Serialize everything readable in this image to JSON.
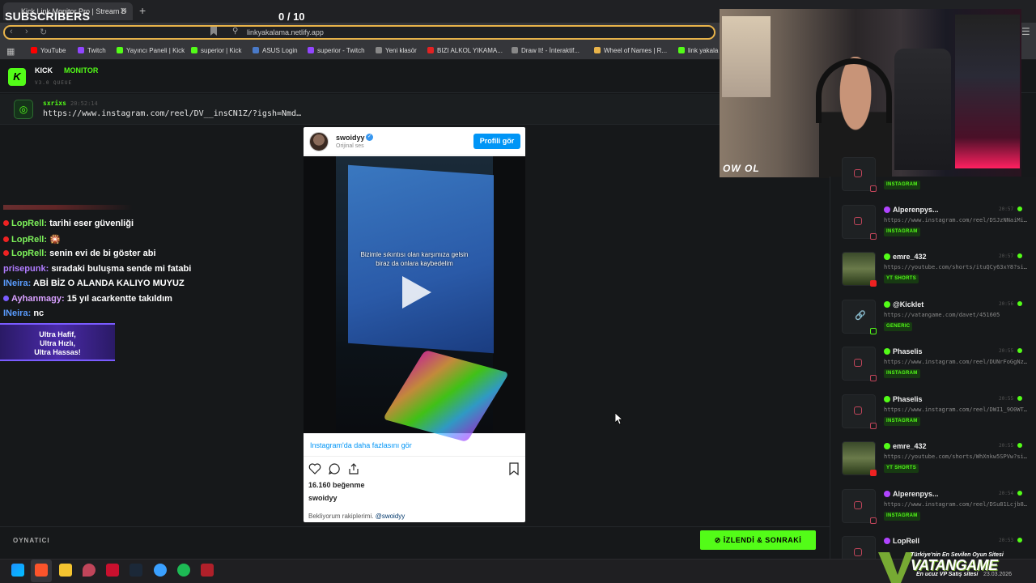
{
  "browser": {
    "tab_title": "Kick Link Monitor Pro | Stream D",
    "url": "linkyakalama.netlify.app",
    "bookmarks": [
      {
        "label": "YouTube",
        "color": "#ff0000"
      },
      {
        "label": "Twitch",
        "color": "#9146ff"
      },
      {
        "label": "Yayıncı Paneli | Kick",
        "color": "#53fc18"
      },
      {
        "label": "superior | Kick",
        "color": "#53fc18"
      },
      {
        "label": "ASUS Login",
        "color": "#4a7ac8"
      },
      {
        "label": "superior - Twitch",
        "color": "#9146ff"
      },
      {
        "label": "Yeni klasör",
        "color": "#888888"
      },
      {
        "label": "BIZI ALKOL YIKAMA...",
        "color": "#e22222"
      },
      {
        "label": "Draw It! - İnteraktif...",
        "color": "#888888"
      },
      {
        "label": "Wheel of Names | R...",
        "color": "#e8b34a"
      },
      {
        "label": "link yakala",
        "color": "#53fc18"
      }
    ]
  },
  "overlay": {
    "subscribers_label": "SUBSCRIBERS",
    "counter": "0 / 10"
  },
  "app": {
    "brand_a": "KICK",
    "brand_b": "MONITOR",
    "version": "V3.0 QUEUE",
    "current": {
      "user": "sxrixs",
      "time": "20:52:14",
      "url": "https://www.instagram.com/reel/DV__insCN1Z/?igsh=Nmd…"
    },
    "player_label": "OYNATICI",
    "next_button": "İZLENDİ & SONRAKİ"
  },
  "chat": [
    {
      "user": "LopRell",
      "msg": "tarihi eser güvenliği",
      "color": "#7cf05a",
      "badge": "#e22"
    },
    {
      "user": "LopRell",
      "msg": "🎇",
      "color": "#7cf05a",
      "badge": "#e22"
    },
    {
      "user": "LopRell",
      "msg": "senin evi de bi göster abi",
      "color": "#7cf05a",
      "badge": "#e22"
    },
    {
      "user": "prisepunk",
      "msg": "sıradaki buluşma sende mi fatabi",
      "color": "#b07cff",
      "badge": ""
    },
    {
      "user": "INeira",
      "msg": "ABİ BİZ O ALANDA KALIYO MUYUZ",
      "color": "#5a9cff",
      "badge": ""
    },
    {
      "user": "Ayhanmagy",
      "msg": "15 yıl acarkentte takıldım",
      "color": "#d8a0ff",
      "badge": "#7a5cff"
    },
    {
      "user": "INeira",
      "msg": "nc",
      "color": "#5a9cff",
      "badge": ""
    }
  ],
  "ad_banner": [
    "Ultra Hafif,",
    "Ultra Hızlı,",
    "Ultra Hassas!"
  ],
  "instagram": {
    "user": "swoidyy",
    "audio": "Orijinal ses",
    "profile_button": "Profili gör",
    "caption_line1": "Bizimle sıkıntısı olan karşımıza gelsin",
    "caption_line2": "biraz da onlara kaybedelim",
    "more_link": "Instagram'da daha fazlasını gör",
    "likes": "16.160 beğenme",
    "caption_user": "swoidyy",
    "caption_text": "Bekliyorum rakiplerimi.",
    "caption_mention": "@swoidyy"
  },
  "webcam": {
    "logo": "OW OL"
  },
  "queue": [
    {
      "user": "",
      "time": "",
      "url": "",
      "tag": "INSTAGRAM",
      "kind": "ig",
      "badge": ""
    },
    {
      "user": "Alperenpys...",
      "time": "20:57",
      "url": "https://www.instagram.com/reel/DSJzNNaiMi…",
      "tag": "INSTAGRAM",
      "kind": "ig",
      "badge": "#b044ff"
    },
    {
      "user": "emre_432",
      "time": "20:57",
      "url": "https://youtube.com/shorts/ituQCy63xY8?si…",
      "tag": "YT SHORTS",
      "kind": "yt",
      "badge": "#53fc18"
    },
    {
      "user": "@Kicklet",
      "time": "20:56",
      "url": "https://vatangame.com/davet/451605",
      "tag": "GENERIC",
      "kind": "gen",
      "badge": "#53fc18"
    },
    {
      "user": "Phaselis",
      "time": "20:55",
      "url": "https://www.instagram.com/reel/DUNrFoGgNz…",
      "tag": "INSTAGRAM",
      "kind": "ig",
      "badge": "#53fc18"
    },
    {
      "user": "Phaselis",
      "time": "20:55",
      "url": "https://www.instagram.com/reel/DWI1_9O0WT…",
      "tag": "INSTAGRAM",
      "kind": "ig",
      "badge": "#53fc18"
    },
    {
      "user": "emre_432",
      "time": "20:55",
      "url": "https://youtube.com/shorts/WhXnkw5SPVw?si…",
      "tag": "YT SHORTS",
      "kind": "yt",
      "badge": "#53fc18"
    },
    {
      "user": "Alperenpys...",
      "time": "20:54",
      "url": "https://www.instagram.com/reel/DSu81Lcjb8…",
      "tag": "INSTAGRAM",
      "kind": "ig",
      "badge": "#b044ff"
    },
    {
      "user": "LopRell",
      "time": "20:53",
      "url": "",
      "tag": "",
      "kind": "ig",
      "badge": "#b044ff"
    }
  ],
  "vatangame": {
    "top": "Türkiye'nin En Sevilen Oyun Sitesi",
    "name": "VATANGAME",
    "sub": "En ucuz VP Satış sitesi",
    "date": "23.03.2026"
  }
}
